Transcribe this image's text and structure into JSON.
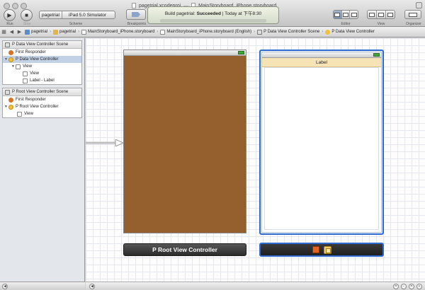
{
  "window": {
    "project_file": "pagetrial.xcodeproj",
    "separator": "—",
    "document_file": "MainStoryboard_iPhone.storyboard"
  },
  "toolbar": {
    "run_label": "Run",
    "stop_label": "Stop",
    "scheme_target": "pagetrial",
    "scheme_destination": "iPad 5.0 Simulator",
    "scheme_label": "Scheme",
    "breakpoints_label": "Breakpoints",
    "editor_label": "Editor",
    "view_label": "View",
    "organizer_label": "Organizer"
  },
  "status": {
    "prefix": "Build pagetrial: ",
    "result": "Succeeded",
    "separator": "  |  ",
    "time": "Today at 下午8:30"
  },
  "jumpbar": {
    "crumbs": [
      "pagetrial",
      "pagetrial",
      "MainStoryboard_iPhone.storyboard",
      "MainStoryboard_iPhone.storyboard (English)",
      "P Data View Controller Scene",
      "P Data View Controller"
    ]
  },
  "outline": {
    "data_scene": {
      "title": "P Data View Controller Scene",
      "first_responder": "First Responder",
      "controller": "P Data View Controller",
      "view": "View",
      "sub_view": "View",
      "label_row": "Label - Label"
    },
    "root_scene": {
      "title": "P Root View Controller Scene",
      "first_responder": "First Responder",
      "controller": "P Root View Controller",
      "view": "View"
    }
  },
  "canvas": {
    "root_dock_title": "P Root View Controller",
    "data_label_text": "Label",
    "root_view_color": "#96602e",
    "selection_color": "#2f6ad0",
    "label_bg_color": "#f6e4b6"
  },
  "icons": {
    "run": "play-icon",
    "stop": "stop-icon",
    "breakpoints": "breakpoint-icon",
    "first_responder": "first-responder-icon",
    "view_controller": "view-controller-icon",
    "battery": "battery-icon"
  }
}
